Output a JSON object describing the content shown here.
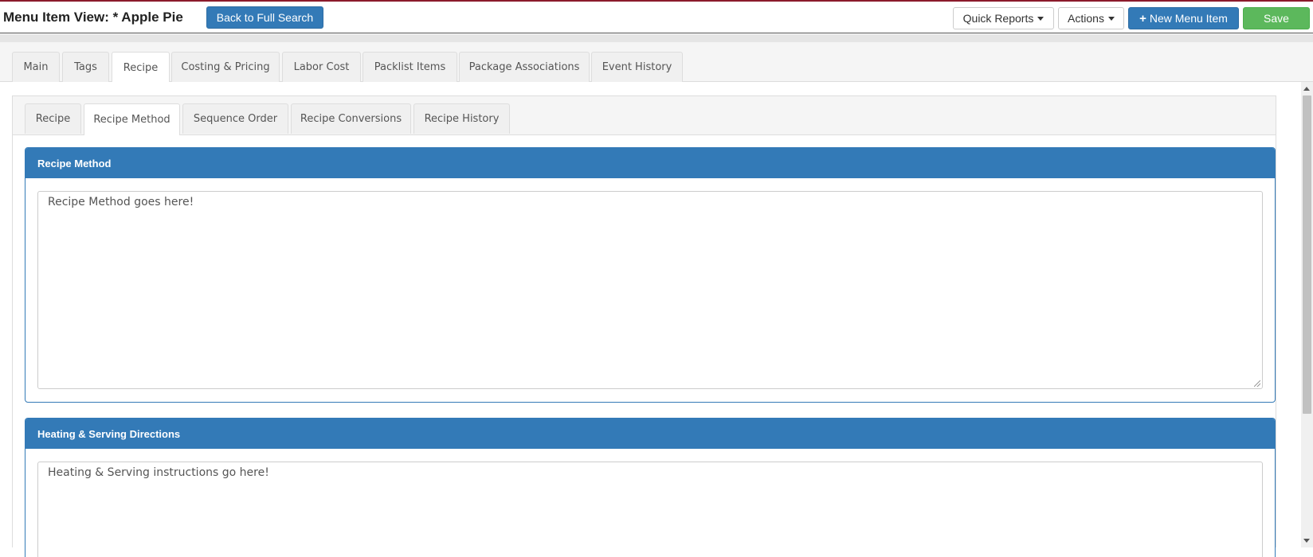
{
  "header": {
    "title": "Menu Item View: * Apple Pie",
    "back_button": "Back to Full Search",
    "quick_reports": "Quick Reports",
    "actions": "Actions",
    "new_menu_item": "New Menu Item",
    "save": "Save"
  },
  "main_tabs": [
    {
      "label": "Main"
    },
    {
      "label": "Tags"
    },
    {
      "label": "Recipe",
      "active": true
    },
    {
      "label": "Costing & Pricing"
    },
    {
      "label": "Labor Cost"
    },
    {
      "label": "Packlist Items"
    },
    {
      "label": "Package Associations"
    },
    {
      "label": "Event History"
    }
  ],
  "recipe_tabs": [
    {
      "label": "Recipe"
    },
    {
      "label": "Recipe Method",
      "active": true
    },
    {
      "label": "Sequence Order"
    },
    {
      "label": "Recipe Conversions"
    },
    {
      "label": "Recipe History"
    }
  ],
  "recipe_method": {
    "heading": "Recipe Method",
    "value": "Recipe Method goes here!"
  },
  "heating_serving": {
    "heading": "Heating & Serving Directions",
    "value": "Heating & Serving instructions go here!"
  },
  "colors": {
    "primary": "#337ab7",
    "success": "#5cb85c",
    "accent": "#8b1a2b"
  }
}
